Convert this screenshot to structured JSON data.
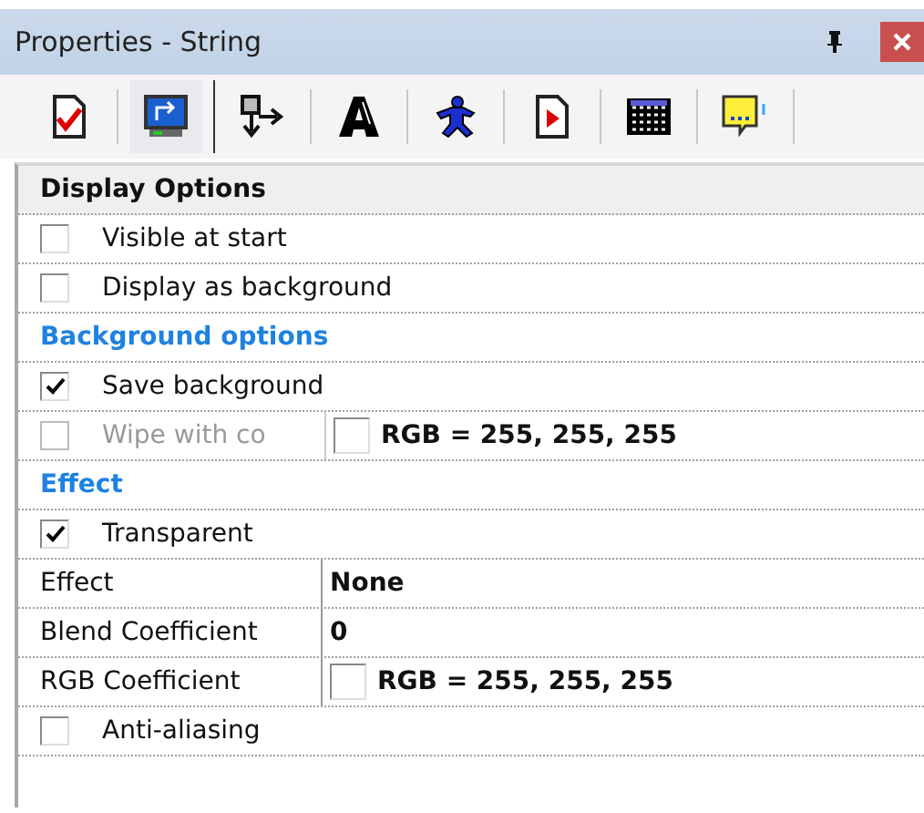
{
  "window": {
    "title": "Properties - String"
  },
  "toolbar": [
    {
      "selected": false
    },
    {
      "selected": true
    },
    {
      "selected": false
    },
    {
      "selected": false
    },
    {
      "selected": false
    },
    {
      "selected": false
    },
    {
      "selected": false
    },
    {
      "selected": false
    }
  ],
  "rows": [
    {
      "kind": "header",
      "label": "Display Options"
    },
    {
      "kind": "checkbox",
      "label": "Visible at start",
      "checked": false,
      "disabled": false
    },
    {
      "kind": "checkbox",
      "label": "Display as background",
      "checked": false,
      "disabled": false
    },
    {
      "kind": "category",
      "label": "Background options"
    },
    {
      "kind": "checkbox",
      "label": "Save background",
      "checked": true,
      "disabled": false
    },
    {
      "kind": "checkbox_color",
      "label": "Wipe with co",
      "checked": false,
      "disabled": true,
      "value": "RGB = 255, 255, 255"
    },
    {
      "kind": "category",
      "label": "Effect"
    },
    {
      "kind": "checkbox",
      "label": "Transparent",
      "checked": true,
      "disabled": false
    },
    {
      "kind": "property",
      "label": "Effect",
      "value": "None"
    },
    {
      "kind": "property",
      "label": "Blend Coefficient",
      "value": "0"
    },
    {
      "kind": "color",
      "label": "RGB Coefficient",
      "value": "RGB = 255, 255, 255"
    },
    {
      "kind": "checkbox",
      "label": "Anti-aliasing",
      "checked": false,
      "disabled": false
    }
  ]
}
